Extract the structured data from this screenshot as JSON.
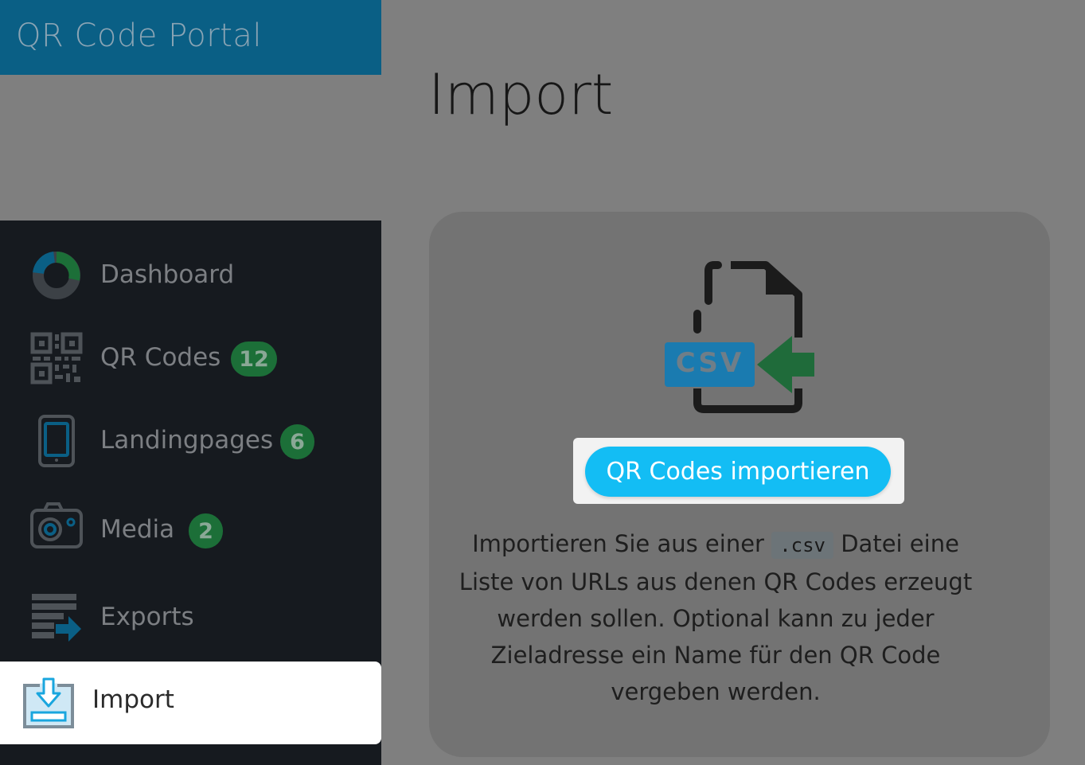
{
  "app": {
    "title": "QR Code Portal"
  },
  "sidebar": {
    "items": [
      {
        "label": "Dashboard",
        "icon": "dashboard-donut-icon"
      },
      {
        "label": "QR Codes",
        "icon": "qr-code-icon",
        "badge": "12"
      },
      {
        "label": "Landingpages",
        "icon": "mobile-phone-icon",
        "badge": "6"
      },
      {
        "label": "Media",
        "icon": "camera-icon",
        "badge": "2"
      },
      {
        "label": "Exports",
        "icon": "export-icon"
      },
      {
        "label": "Import",
        "icon": "import-tray-icon",
        "active": true
      }
    ]
  },
  "main": {
    "title": "Import",
    "csv_tag": "CSV",
    "button_label": "QR Codes importieren",
    "description": {
      "before": "Importieren Sie aus einer ",
      "code": ".csv",
      "after": " Datei eine Liste von URLs aus denen QR Codes erzeugt werden sollen. Optional kann zu jeder Zieladresse ein Name für den QR Code vergeben werden."
    }
  },
  "colors": {
    "brand_bar": "#0a5f85",
    "sidebar_bg": "#161a1f",
    "badge_green": "#1c6f38",
    "button_blue": "#13bdf4",
    "csv_blue": "#1a7bb0",
    "arrow_green": "#1f6b3a"
  }
}
